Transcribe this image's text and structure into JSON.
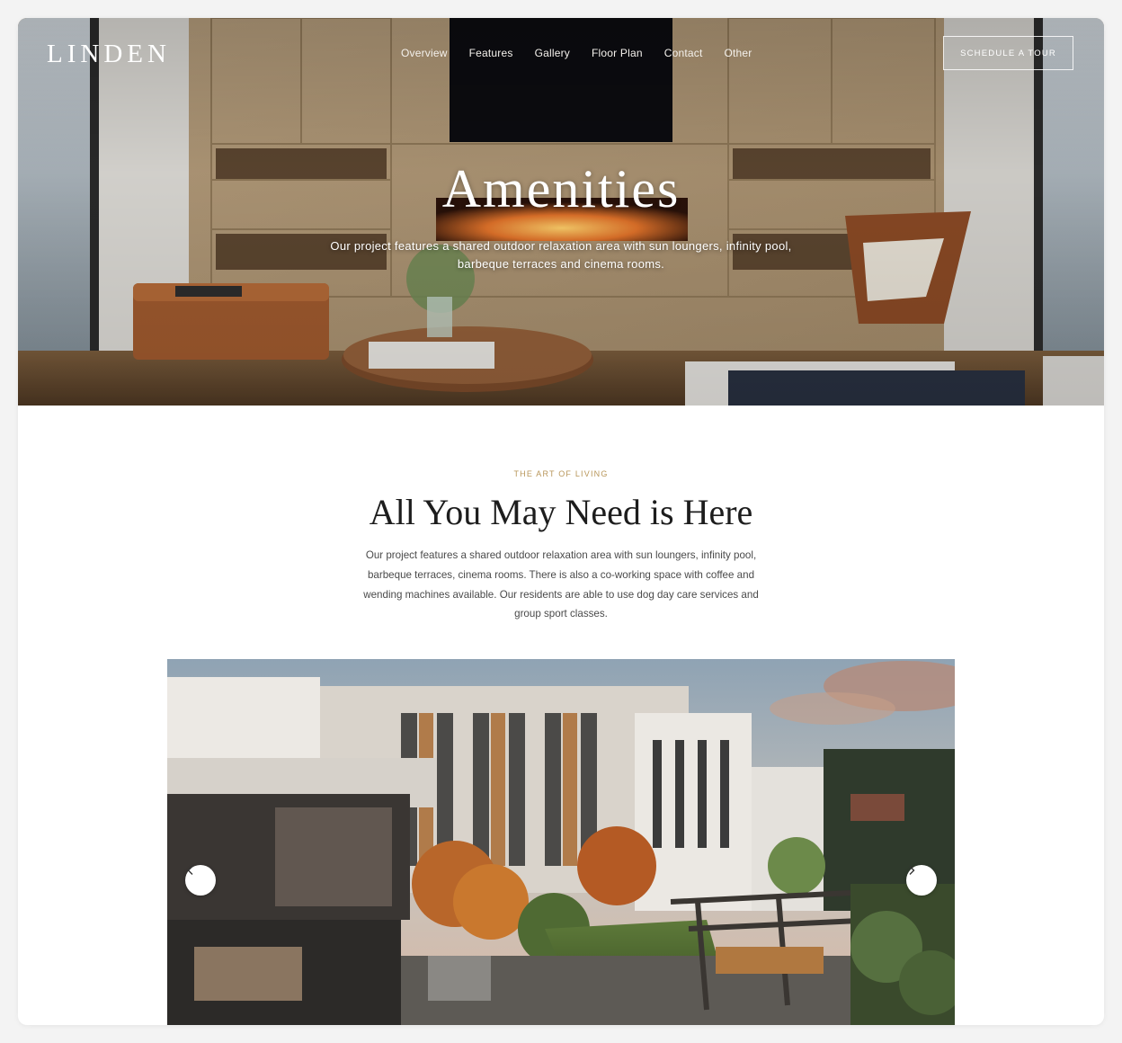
{
  "header": {
    "logo": "LINDEN",
    "nav": [
      "Overview",
      "Features",
      "Gallery",
      "Floor Plan",
      "Contact",
      "Other"
    ],
    "cta_label": "SCHEDULE A TOUR"
  },
  "hero": {
    "title": "Amenities",
    "subtitle": "Our project features a shared outdoor relaxation area with sun loungers, infinity pool, barbeque terraces and cinema rooms."
  },
  "section": {
    "eyebrow": "THE ART OF LIVING",
    "heading": "All You May Need is Here",
    "body": "Our project features a shared outdoor relaxation area with sun loungers, infinity pool, barbeque terraces, cinema rooms. There is also a co-working space with coffee and wending machines available. Our residents are able to use dog day care services and group sport classes."
  },
  "carousel": {
    "prev_icon": "chevron-left-icon",
    "next_icon": "chevron-right-icon"
  },
  "colors": {
    "accent": "#b8965a",
    "heading": "#1d1d1d",
    "body_text": "#4a4a4a"
  }
}
